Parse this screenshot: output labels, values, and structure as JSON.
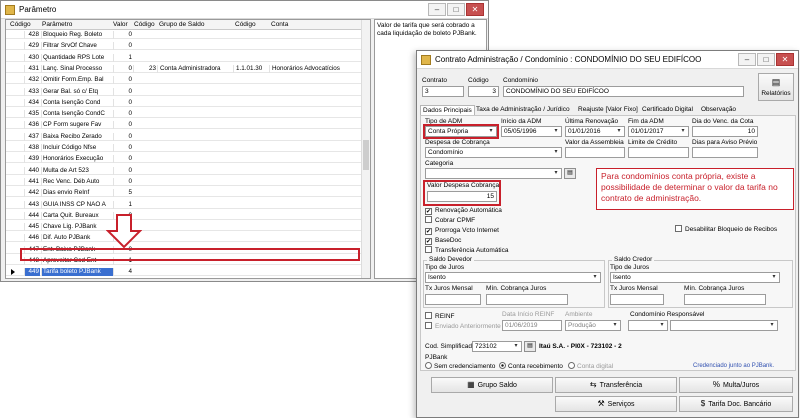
{
  "param_window": {
    "title": "Parâmetro",
    "columns": [
      "Código",
      "Parâmetro",
      "Valor",
      "Código",
      "Grupo de Saldo",
      "Código",
      "Conta"
    ],
    "rows": [
      {
        "codigo": "428",
        "parametro": "Bloqueio Reg. Boleto",
        "valor": "0",
        "codigo2": "",
        "grupo": "",
        "codigo3": "",
        "conta": ""
      },
      {
        "codigo": "429",
        "parametro": "Filtrar SrvOf Chave",
        "valor": "0",
        "codigo2": "",
        "grupo": "",
        "codigo3": "",
        "conta": ""
      },
      {
        "codigo": "430",
        "parametro": "Quantidade RPS Lote",
        "valor": "1",
        "codigo2": "",
        "grupo": "",
        "codigo3": "",
        "conta": ""
      },
      {
        "codigo": "431",
        "parametro": "Lanç. Sinal Processo",
        "valor": "0",
        "codigo2": "23",
        "grupo": "Conta Administradora",
        "codigo3": "1.1.01.30",
        "conta": "Honorários Advocatícios"
      },
      {
        "codigo": "432",
        "parametro": "Omitir Form.Emp. Bal",
        "valor": "0",
        "codigo2": "",
        "grupo": "",
        "codigo3": "",
        "conta": ""
      },
      {
        "codigo": "433",
        "parametro": "Gerar Bal. só c/ Etq",
        "valor": "0",
        "codigo2": "",
        "grupo": "",
        "codigo3": "",
        "conta": ""
      },
      {
        "codigo": "434",
        "parametro": "Conta Isenção Cond",
        "valor": "0",
        "codigo2": "",
        "grupo": "",
        "codigo3": "",
        "conta": ""
      },
      {
        "codigo": "435",
        "parametro": "Conta Isenção CondC",
        "valor": "0",
        "codigo2": "",
        "grupo": "",
        "codigo3": "",
        "conta": ""
      },
      {
        "codigo": "436",
        "parametro": "CP Form sugere Fav",
        "valor": "0",
        "codigo2": "",
        "grupo": "",
        "codigo3": "",
        "conta": ""
      },
      {
        "codigo": "437",
        "parametro": "Baixa Recibo Zerado",
        "valor": "0",
        "codigo2": "",
        "grupo": "",
        "codigo3": "",
        "conta": ""
      },
      {
        "codigo": "438",
        "parametro": "Incluir Código Nfse",
        "valor": "0",
        "codigo2": "",
        "grupo": "",
        "codigo3": "",
        "conta": ""
      },
      {
        "codigo": "439",
        "parametro": "Honorários Execução",
        "valor": "0",
        "codigo2": "",
        "grupo": "",
        "codigo3": "",
        "conta": ""
      },
      {
        "codigo": "440",
        "parametro": "Multa de Art 523",
        "valor": "0",
        "codigo2": "",
        "grupo": "",
        "codigo3": "",
        "conta": ""
      },
      {
        "codigo": "441",
        "parametro": "Rec Venc. Déb Auto",
        "valor": "0",
        "codigo2": "",
        "grupo": "",
        "codigo3": "",
        "conta": ""
      },
      {
        "codigo": "442",
        "parametro": "Dias envio ReInf",
        "valor": "5",
        "codigo2": "",
        "grupo": "",
        "codigo3": "",
        "conta": ""
      },
      {
        "codigo": "443",
        "parametro": "GUIA INSS CP NÃO A",
        "valor": "1",
        "codigo2": "",
        "grupo": "",
        "codigo3": "",
        "conta": ""
      },
      {
        "codigo": "444",
        "parametro": "Carta Quit. Bureaux",
        "valor": "0",
        "codigo2": "",
        "grupo": "",
        "codigo3": "",
        "conta": ""
      },
      {
        "codigo": "445",
        "parametro": "Chave Lig. PJBank",
        "valor": "",
        "codigo2": "",
        "grupo": "",
        "codigo3": "",
        "conta": ""
      },
      {
        "codigo": "446",
        "parametro": "Dif. Auto PJBank",
        "valor": "0",
        "codigo2": "",
        "grupo": "",
        "codigo3": "",
        "conta": ""
      },
      {
        "codigo": "447",
        "parametro": "Ent. Baixa PJBank",
        "valor": "0",
        "codigo2": "",
        "grupo": "",
        "codigo3": "",
        "conta": ""
      },
      {
        "codigo": "448",
        "parametro": "Aproveitar Cod Ent",
        "valor": "1",
        "codigo2": "",
        "grupo": "",
        "codigo3": "",
        "conta": ""
      },
      {
        "codigo": "449",
        "parametro": "Tarifa boleto PJBank",
        "valor": "4",
        "codigo2": "",
        "grupo": "",
        "codigo3": "",
        "conta": ""
      }
    ],
    "description": "Valor de tarifa que será cobrado a cada liquidação de boleto PJBank."
  },
  "contrato_window": {
    "title": "Contrato Administração / Condomínio : CONDOMÍNIO DO SEU EDIFÍCOO",
    "labels": {
      "contrato": "Contrato",
      "codigo": "Código",
      "condominio": "Condomínio"
    },
    "contrato_value": "3",
    "codigo_value": "3",
    "condominio_value": "CONDOMÍNIO DO SEU EDIFÍCOO",
    "relatorios": "Relatórios",
    "tabs": [
      "Dados Principais",
      "Taxa de Administração / Jurídico",
      "Reajuste [Valor Fixo]",
      "Certificado Digital",
      "Observação"
    ],
    "fields": {
      "tipo_adm_label": "Tipo de ADM",
      "tipo_adm_value": "Conta Própria",
      "inicio_adm_label": "Início da ADM",
      "inicio_adm_value": "05/05/1996",
      "ultima_renovacao_label": "Última Renovação",
      "ultima_renovacao_value": "01/01/2016",
      "fim_adm_label": "Fim da ADM",
      "fim_adm_value": "01/01/2017",
      "dia_venc_label": "Dia do Venc. da Cota",
      "dia_venc_value": "10",
      "despesa_cobranca_label": "Despesa de Cobrança",
      "despesa_cobranca_value": "Condomínio",
      "valor_assembleia_label": "Valor da Assembleia",
      "limite_credito_label": "Limite de Crédito",
      "dias_aviso_label": "Dias para Aviso Prévio",
      "categoria_label": "Categoria",
      "valor_despesa_label": "Valor Despesa Cobrança",
      "valor_despesa_value": "15"
    },
    "checks": {
      "renovacao": "Renovação Automática",
      "cobrar_cpmf": "Cobrar CPMF",
      "prorroga": "Prorroga Vcto Internet",
      "basedoc": "BaseDoc",
      "transferencia": "Transferência Automática",
      "desabilitar": "Desabilitar Bloqueio de Recibos",
      "reinf": "REINF",
      "enviado": "Enviado Anteriormente"
    },
    "saldo_devedor": {
      "title": "Saldo Devedor",
      "tipo_juros": "Tipo de Juros",
      "tipo_juros_value": "Isento",
      "tx_juros": "Tx Juros Mensal",
      "min_cobranca": "Mín. Cobrança Juros"
    },
    "saldo_credor": {
      "title": "Saldo Credor",
      "tipo_juros": "Tipo de Juros",
      "tipo_juros_value": "Isento",
      "tx_juros": "Tx Juros Mensal",
      "min_cobranca": "Mín. Cobrança Juros"
    },
    "reinf_row": {
      "data_inicio_label": "Data Início REINF",
      "data_inicio_value": "01/06/2019",
      "ambiente_label": "Ambiente",
      "ambiente_value": "Produção",
      "condominio_resp_label": "Condomínio Responsável"
    },
    "cod_simplificado_label": "Cod. Simplificado",
    "cod_simplificado_value": "723102",
    "bank_text": "Itaú S.A. - PI0X - 723102 - 2",
    "pjbank": {
      "label": "PJBank",
      "options": [
        "Sem credenciamento",
        "Conta recebimento",
        "Conta digital"
      ],
      "credenciado": "Credenciado junto ao PJBank."
    },
    "buttons": {
      "grupo_saldo": "Grupo Saldo",
      "transferencia": "Transferência",
      "multa_juros": "Multa/Juros",
      "servicos": "Serviços",
      "tarifa_doc": "Tarifa Doc. Bancário"
    }
  },
  "annotation": "Para condomínios conta própria, existe a possibilidade de determinar o valor da tarifa no contrato de administração.",
  "colors": {
    "highlight": "#c8202b",
    "selection": "#3a6fd0"
  }
}
